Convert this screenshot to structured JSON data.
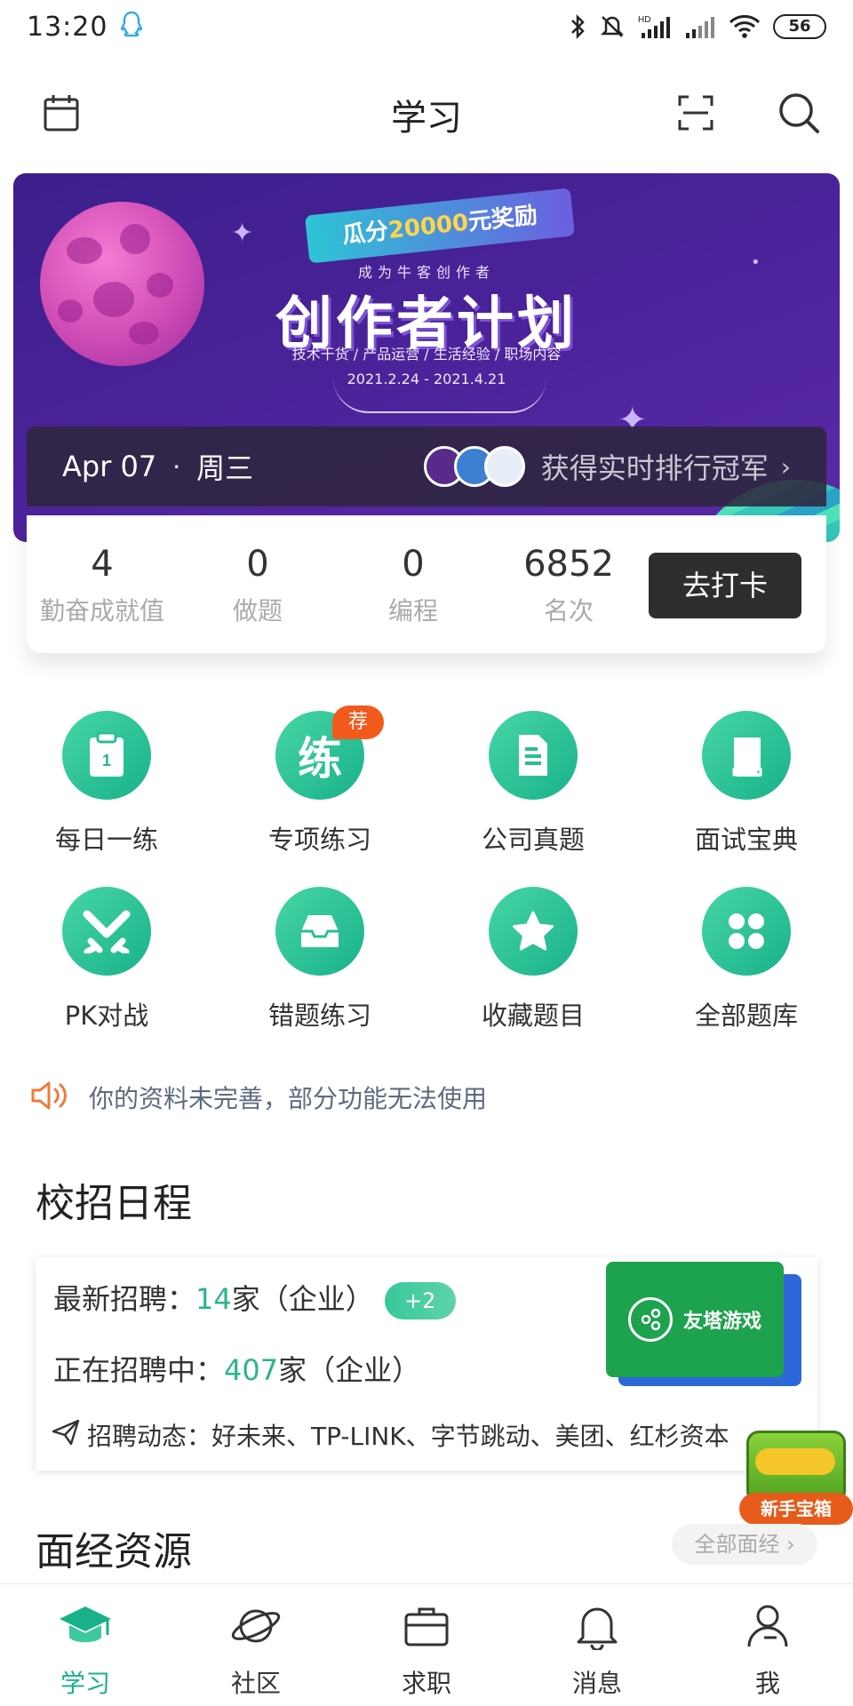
{
  "status_bar": {
    "time": "13:20",
    "battery": "56",
    "icons": [
      "qq-icon",
      "bluetooth-icon",
      "mute-icon",
      "signal-hd-icon",
      "signal-icon",
      "wifi-icon",
      "battery-icon"
    ]
  },
  "header": {
    "title": "学习",
    "left_icon": "calendar-icon",
    "right_icons": [
      "scan-icon",
      "search-icon"
    ]
  },
  "banner": {
    "ribbon_prefix": "瓜分",
    "ribbon_amount": "20000",
    "ribbon_suffix": "元奖励",
    "subtitle": "成为牛客创作者",
    "title": "创作者计划",
    "tags": "技术干货 / 产品运营 / 生活经验 / 职场内容",
    "date_range": "2021.2.24 - 2021.4.21",
    "strip_date": "Apr 07",
    "strip_dot": "·",
    "strip_weekday": "周三",
    "strip_rank_text": "获得实时排行冠军",
    "strip_chevron": "›"
  },
  "stats": {
    "items": [
      {
        "value": "4",
        "label": "勤奋成就值"
      },
      {
        "value": "0",
        "label": "做题"
      },
      {
        "value": "0",
        "label": "编程"
      },
      {
        "value": "6852",
        "label": "名次"
      }
    ],
    "checkin_label": "去打卡"
  },
  "features": [
    {
      "label": "每日一练",
      "icon": "clipboard-icon"
    },
    {
      "label": "专项练习",
      "icon": "practice-icon",
      "glyph": "练",
      "badge": "荐"
    },
    {
      "label": "公司真题",
      "icon": "document-icon"
    },
    {
      "label": "面试宝典",
      "icon": "book-icon"
    },
    {
      "label": "PK对战",
      "icon": "pk-battle-icon"
    },
    {
      "label": "错题练习",
      "icon": "tray-icon"
    },
    {
      "label": "收藏题目",
      "icon": "star-icon"
    },
    {
      "label": "全部题库",
      "icon": "grid-icon"
    }
  ],
  "notice": {
    "text": "你的资料未完善，部分功能无法使用"
  },
  "campus": {
    "title": "校招日程",
    "latest_label": "最新招聘：",
    "latest_count": "14",
    "latest_unit": "家（企业）",
    "latest_plus": "+2",
    "ongoing_label": "正在招聘中：",
    "ongoing_count": "407",
    "ongoing_unit": "家（企业）",
    "dynamic_label": "招聘动态：",
    "dynamic_list": "好未来、TP-LINK、字节跳动、美团、红杉资本",
    "company_name": "友塔游戏"
  },
  "treasure": {
    "label": "新手宝箱"
  },
  "interview": {
    "title": "面经资源",
    "all_button": "全部面经 ›"
  },
  "bottom_nav": [
    {
      "label": "学习",
      "icon": "graduation-cap-icon",
      "active": true
    },
    {
      "label": "社区",
      "icon": "planet-icon"
    },
    {
      "label": "求职",
      "icon": "briefcase-icon"
    },
    {
      "label": "消息",
      "icon": "bell-icon"
    },
    {
      "label": "我",
      "icon": "person-icon"
    }
  ],
  "colors": {
    "accent_green": "#19b18a",
    "badge_orange": "#f25a1c",
    "banner_purple": "#4a2298"
  }
}
